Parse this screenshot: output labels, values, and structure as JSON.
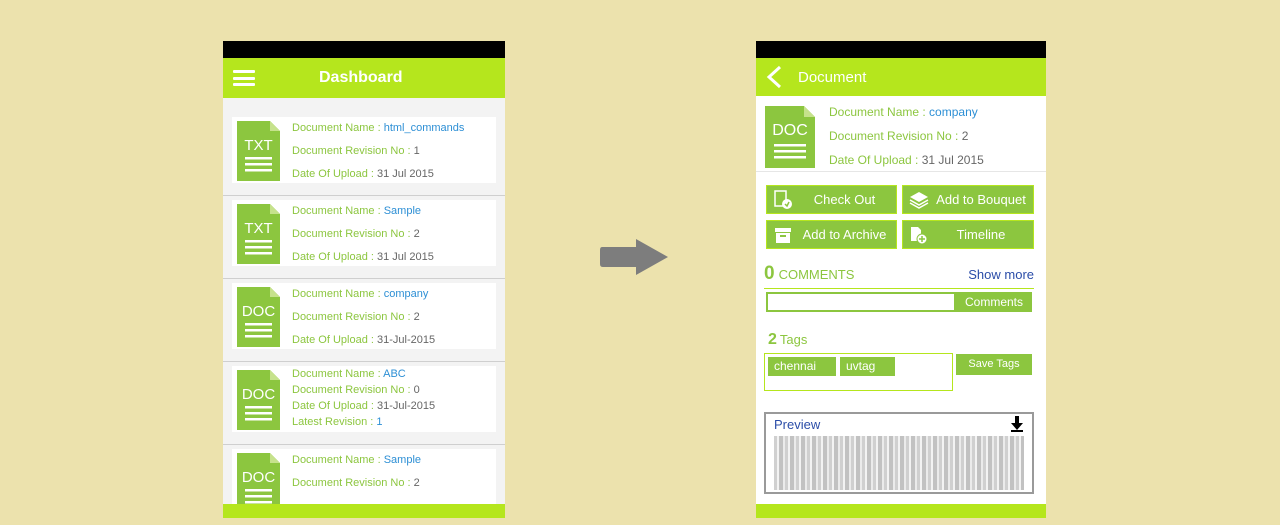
{
  "dashboard": {
    "title": "Dashboard",
    "documents": [
      {
        "type": "TXT",
        "name_label": "Document Name :",
        "name": "html_commands",
        "rev_label": "Document Revision No :",
        "rev": "1",
        "date_label": "Date Of Upload :",
        "date": "31 Jul 2015"
      },
      {
        "type": "TXT",
        "name_label": "Document Name :",
        "name": "Sample",
        "rev_label": "Document Revision No :",
        "rev": "2",
        "date_label": "Date Of Upload :",
        "date": "31 Jul 2015"
      },
      {
        "type": "DOC",
        "name_label": "Document Name :",
        "name": "company",
        "rev_label": "Document Revision No :",
        "rev": "2",
        "date_label": "Date Of Upload :",
        "date": "31-Jul-2015"
      },
      {
        "type": "DOC",
        "name_label": "Document Name :",
        "name": "ABC",
        "rev_label": "Document Revision No :",
        "rev": "0",
        "date_label": "Date Of Upload :",
        "date": "31-Jul-2015",
        "latest_label": "Latest Revision :",
        "latest": "1"
      },
      {
        "type": "DOC",
        "name_label": "Document Name :",
        "name": "Sample",
        "rev_label": "Document Revision No :",
        "rev": "2"
      }
    ]
  },
  "document": {
    "title": "Document",
    "type": "DOC",
    "name_label": "Document Name :",
    "name": "company",
    "rev_label": "Document Revision No :",
    "rev": "2",
    "date_label": "Date Of Upload :",
    "date": "31 Jul 2015",
    "actions": {
      "check_out": "Check Out",
      "add_bouquet": "Add to Bouquet",
      "add_archive": "Add to Archive",
      "timeline": "Timeline"
    },
    "comments": {
      "count": "0",
      "label": "COMMENTS",
      "show_more": "Show more",
      "button": "Comments"
    },
    "tags": {
      "count": "2",
      "label": "Tags",
      "items": [
        "chennai",
        "uvtag"
      ],
      "save": "Save Tags"
    },
    "preview": {
      "label": "Preview"
    }
  },
  "colors": {
    "appbar": "#b5e61d",
    "accent": "#8cc63f",
    "link": "#2d8fd5",
    "background": "#ece2ad"
  }
}
